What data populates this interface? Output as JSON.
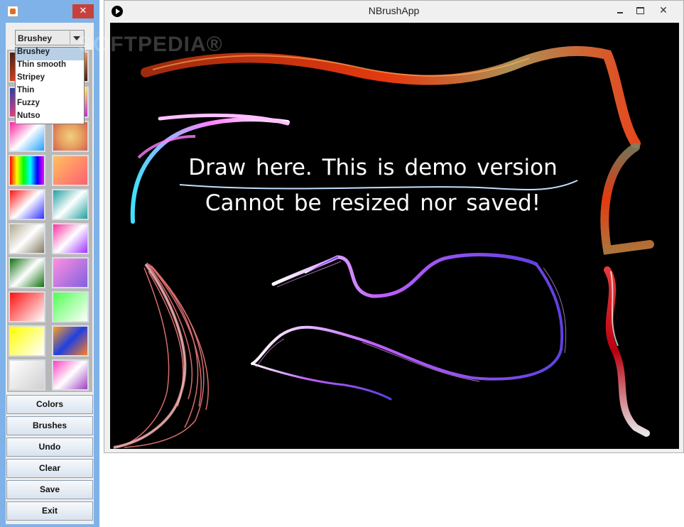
{
  "toolwin": {
    "close_glyph": "✕"
  },
  "brush_combo": {
    "selected": "Brushey",
    "options": [
      "Brushey",
      "Thin smooth",
      "Stripey",
      "Thin",
      "Fuzzy",
      "Nutso"
    ]
  },
  "watermark": "SOFTPEDIA®",
  "buttons": {
    "colors": "Colors",
    "brushes": "Brushes",
    "undo": "Undo",
    "clear": "Clear",
    "save": "Save",
    "exit": "Exit"
  },
  "mainwin": {
    "title": "NBrushApp",
    "close_glyph": "✕"
  },
  "canvas": {
    "line1": "Draw here. This is  demo  version",
    "line2": "Cannot  be   resized  nor saved!"
  }
}
